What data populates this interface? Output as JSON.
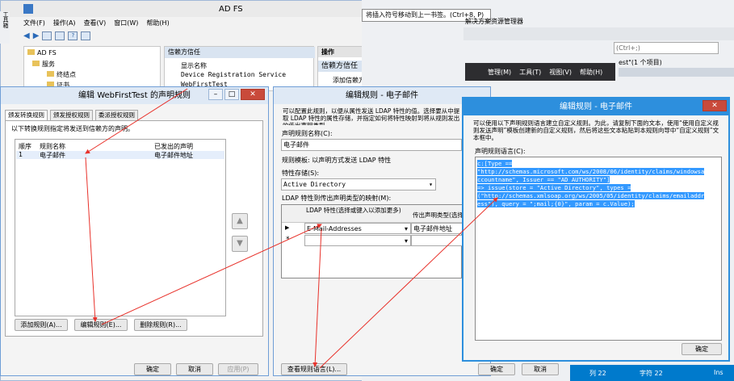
{
  "adfs": {
    "title": "AD FS",
    "menu": [
      "文件(F)",
      "操作(A)",
      "查看(V)",
      "窗口(W)",
      "帮助(H)"
    ],
    "tree": [
      "AD FS",
      "服务",
      "终结点",
      "证书"
    ],
    "center_header": "信赖方信任",
    "center_col": "显示名称",
    "center_rows": [
      "Device Registration Service",
      "WebFirstTest"
    ],
    "actions_header": "操作",
    "actions_section": "信赖方信任",
    "actions_items": [
      "添加信赖方信任..."
    ]
  },
  "tooltip": "将插入符号移动到上一书签。(Ctrl+8, P)",
  "vs": {
    "title": "解决方案资源管理器",
    "search_placeholder": "(Ctrl+;)",
    "solution_text": "est\"(1 个项目)",
    "left_tab": "工具箱",
    "menu": [
      "管理(M)",
      "工具(T)",
      "视图(V)",
      "帮助(H)"
    ],
    "status": {
      "col": "列 22",
      "char": "字符 22",
      "ins": "Ins"
    }
  },
  "claims_dialog": {
    "title": "编辑 WebFirstTest 的声明规则",
    "tabs": [
      "颁发转换规则",
      "颁发授权规则",
      "委派授权规则"
    ],
    "description": "以下转换规则指定将发送到信赖方的声明。",
    "columns": [
      "顺序",
      "规则名称",
      "已发出的声明"
    ],
    "rows": [
      {
        "order": "1",
        "name": "电子邮件",
        "claim": "电子邮件地址"
      }
    ],
    "add": "添加规则(A)...",
    "edit": "编辑规则(E)...",
    "remove": "删除规则(R)...",
    "ok": "确定",
    "cancel": "取消",
    "apply": "应用(P)"
  },
  "edit_rule": {
    "title": "编辑规则 - 电子邮件",
    "description": "可以配置此规则，以便从属性发送 LDAP 特性的值。选择要从中提取 LDAP 特性的属性存储，并指定如何将特性映射到将从规则发出的传出声明类型。",
    "name_label": "声明规则名称(C):",
    "name_value": "电子邮件",
    "template": "规则模板: 以声明方式发送 LDAP 特性",
    "store_label": "特性存储(S):",
    "store_value": "Active Directory",
    "mapping_label": "LDAP 特性到传出声明类型的映射(M):",
    "col_ldap": "LDAP 特性(选择或键入以添加更多)",
    "col_out": "传出声明类型(选择",
    "map_ldap": "E-Mail-Addresses",
    "map_out": "电子邮件地址",
    "new_row_marker": "*",
    "view_lang": "查看规则语言(L)...",
    "ok": "确定",
    "cancel": "取消"
  },
  "lang_dialog": {
    "title": "编辑规则 - 电子邮件",
    "description": "可以使用以下声明规则语言建立自定义规则。为此，请复制下面的文本，使用“使用自定义规则发送声明”模板创建新的自定义规则，然后将这些文本粘贴到本规则向导中“自定义规则”文本框中。",
    "label": "声明规则语言(C):",
    "code": [
      "c:[Type ==",
      "\"http://schemas.microsoft.com/ws/2008/06/identity/claims/windowsa",
      "ccountname\", Issuer == \"AD AUTHORITY\"]",
      " => issue(store = \"Active Directory\", types =",
      "(\"http://schemas.xmlsoap.org/ws/2005/05/identity/claims/emailaddr",
      "ess\"), query = \";mail;{0}\", param = c.Value);"
    ],
    "ok": "确定"
  },
  "colors": {
    "accent": "#3399ff",
    "arrow": "#e8322b",
    "vs_status": "#007acc"
  }
}
